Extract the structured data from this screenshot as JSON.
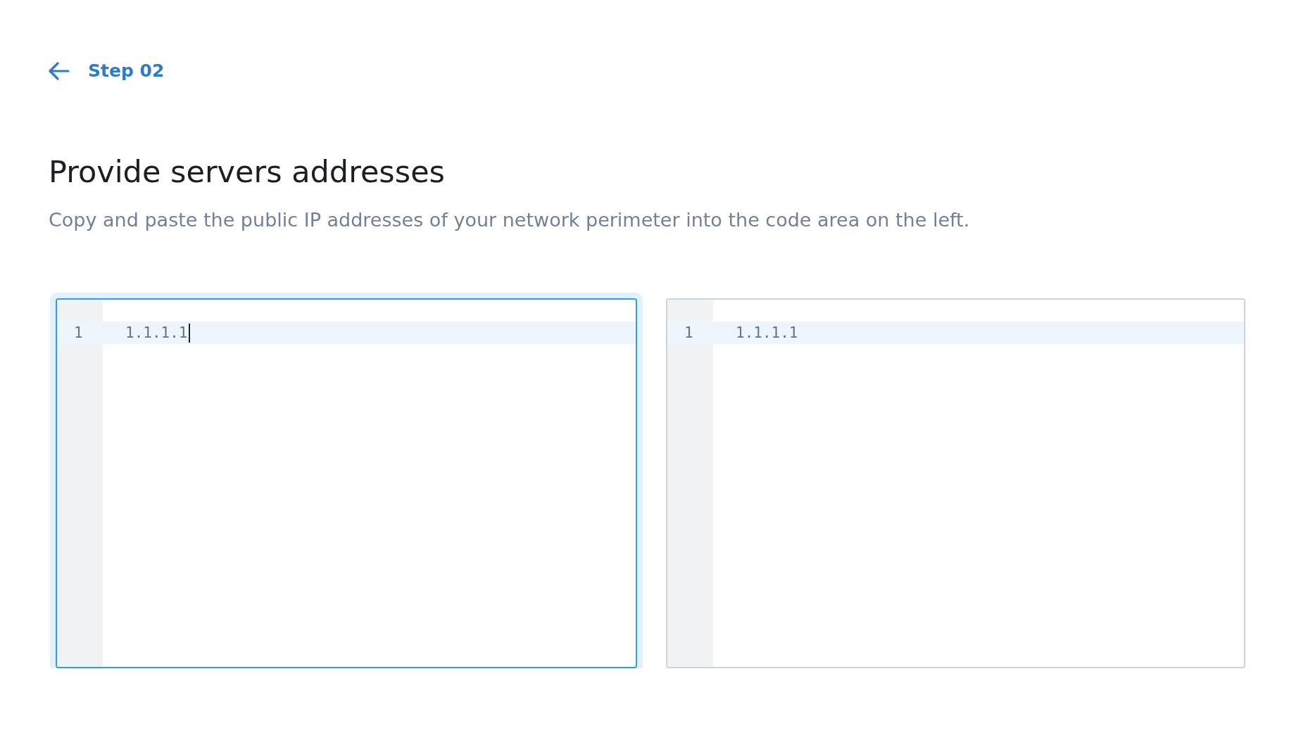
{
  "back_link": {
    "label": "Step 02"
  },
  "title": "Provide servers addresses",
  "description": "Copy and paste the public IP addresses of your network perimeter into the code area on the left.",
  "editors": [
    {
      "focused": true,
      "lines": [
        {
          "number": "1",
          "text": "1.1.1.1",
          "active": true
        }
      ]
    },
    {
      "focused": false,
      "lines": [
        {
          "number": "1",
          "text": "1.1.1.1",
          "active": true
        }
      ]
    }
  ]
}
